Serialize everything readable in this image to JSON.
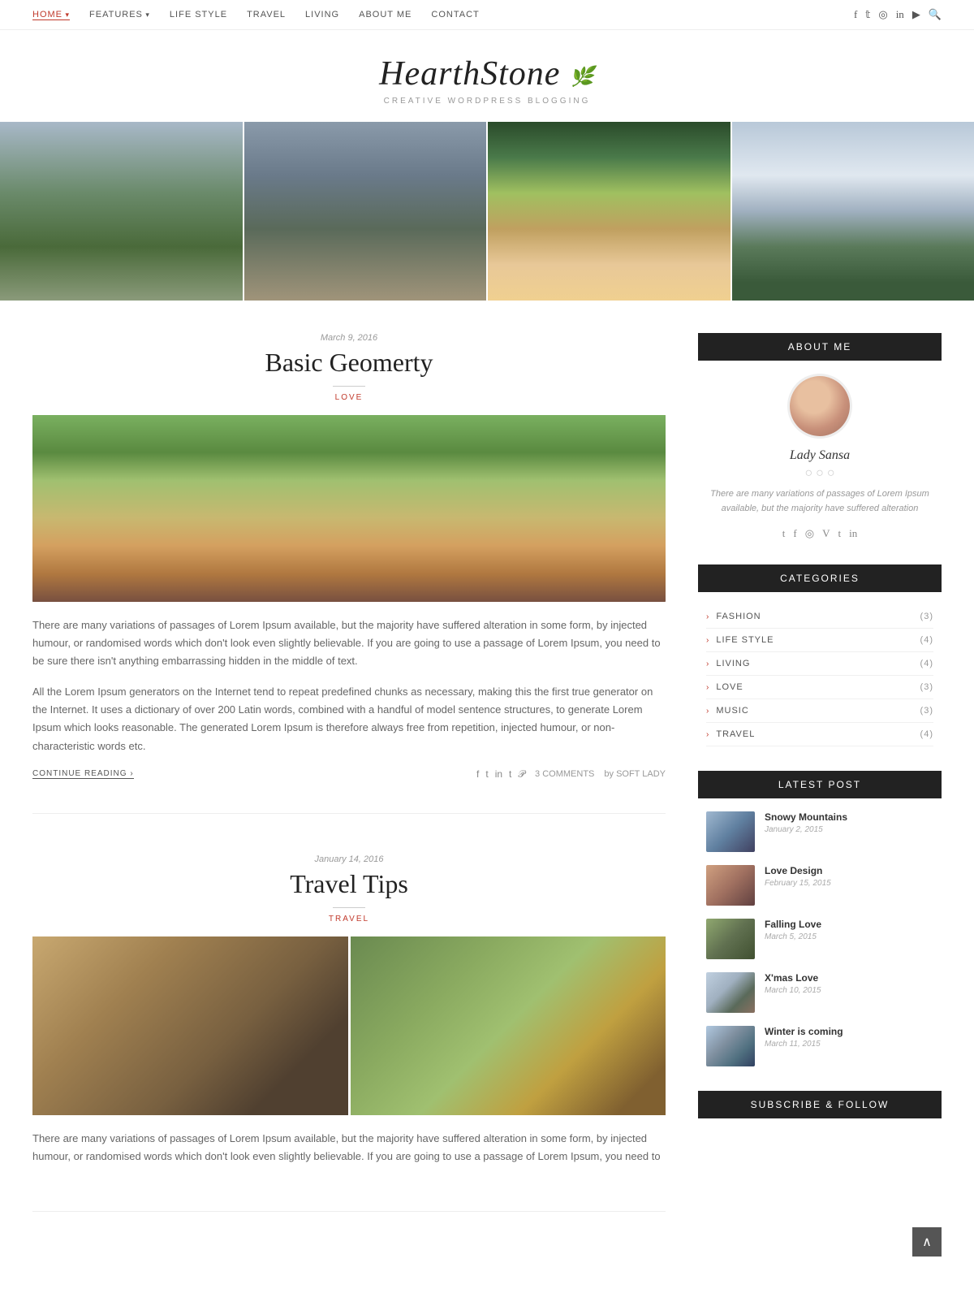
{
  "nav": {
    "links": [
      {
        "label": "HOME",
        "active": true,
        "hasArrow": true
      },
      {
        "label": "FEATURES",
        "active": false,
        "hasArrow": true
      },
      {
        "label": "LIFE STYLE",
        "active": false,
        "hasArrow": false
      },
      {
        "label": "TRAVEL",
        "active": false,
        "hasArrow": false
      },
      {
        "label": "LIVING",
        "active": false,
        "hasArrow": false
      },
      {
        "label": "ABOUT ME",
        "active": false,
        "hasArrow": false
      },
      {
        "label": "CONTACT",
        "active": false,
        "hasArrow": false
      }
    ],
    "social_icons": [
      "f",
      "t",
      "📷",
      "in",
      "▶",
      "🔍"
    ]
  },
  "site": {
    "title": "HearthStone",
    "tagline": "CREATIVE WORDPRESS BLOGGING"
  },
  "posts": [
    {
      "date": "March 9, 2016",
      "title": "Basic Geomerty",
      "category": "LOVE",
      "excerpt1": "There are many variations of passages of Lorem Ipsum available, but the majority have suffered alteration in some form, by injected humour, or randomised words which don't look even slightly believable. If you are going to use a passage of Lorem Ipsum, you need to be sure there isn't anything embarrassing hidden in the middle of text.",
      "excerpt2": "All the Lorem Ipsum generators on the Internet tend to repeat predefined chunks as necessary, making this the first true generator on the Internet. It uses a dictionary of over 200 Latin words, combined with a handful of model sentence structures, to generate Lorem Ipsum which looks reasonable. The generated Lorem Ipsum is therefore always free from repetition, injected humour, or non-characteristic words etc.",
      "continue_label": "CONTINUE READING",
      "comments": "3 COMMENTS",
      "author": "by SOFT LADY"
    },
    {
      "date": "January 14, 2016",
      "title": "Travel Tips",
      "category": "TRAVEL",
      "excerpt1": "There are many variations of passages of Lorem Ipsum available, but the majority have suffered alteration in some form, by injected humour, or randomised words which don't look even slightly believable. If you are going to use a passage of Lorem Ipsum, you need to"
    }
  ],
  "sidebar": {
    "about_title": "About me",
    "author_name": "Lady Sansa",
    "author_dots": "○ ○ ○",
    "author_bio": "There are many variations of passages of Lorem Ipsum available, but the majority have suffered alteration",
    "author_social": [
      "t",
      "f",
      "◎",
      "V",
      "t",
      "in"
    ],
    "categories_title": "Categories",
    "categories": [
      {
        "name": "FASHION",
        "count": "(3)"
      },
      {
        "name": "LIFE STYLE",
        "count": "(4)"
      },
      {
        "name": "LIVING",
        "count": "(4)"
      },
      {
        "name": "LOVE",
        "count": "(3)"
      },
      {
        "name": "MUSIC",
        "count": "(3)"
      },
      {
        "name": "TRAVEL",
        "count": "(4)"
      }
    ],
    "latest_title": "Latest Post",
    "latest_posts": [
      {
        "title": "Snowy Mountains",
        "date": "January 2, 2015",
        "thumb": "thumb-1"
      },
      {
        "title": "Love Design",
        "date": "February 15, 2015",
        "thumb": "thumb-2"
      },
      {
        "title": "Falling Love",
        "date": "March 5, 2015",
        "thumb": "thumb-3"
      },
      {
        "title": "X'mas Love",
        "date": "March 10, 2015",
        "thumb": "thumb-4"
      },
      {
        "title": "Winter is coming",
        "date": "March 11, 2015",
        "thumb": "thumb-5"
      }
    ],
    "subscribe_title": "Subscribe & Follow"
  }
}
